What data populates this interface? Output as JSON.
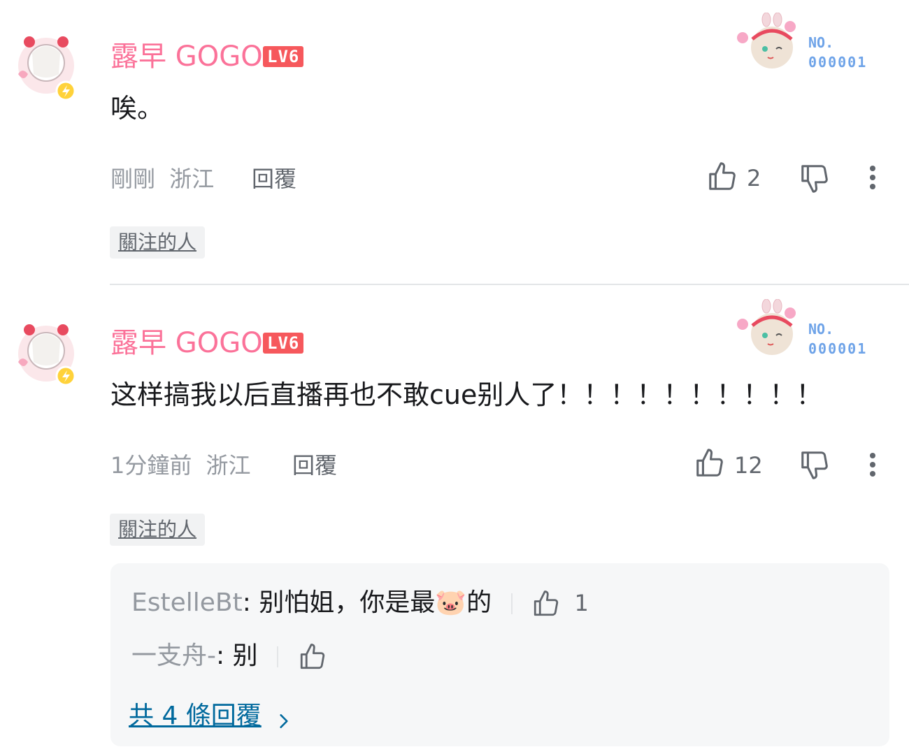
{
  "comments": [
    {
      "username": "露早 GOGO",
      "level": "LV6",
      "badge_no": "NO.",
      "badge_num": "000001",
      "text": "唉。",
      "time": "剛剛",
      "location": "浙江",
      "reply_label": "回覆",
      "likes": "2",
      "tag": "關注的人"
    },
    {
      "username": "露早 GOGO",
      "level": "LV6",
      "badge_no": "NO.",
      "badge_num": "000001",
      "text": "这样搞我以后直播再也不敢cue别人了！！！！！！！！！！",
      "time": "1分鐘前",
      "location": "浙江",
      "reply_label": "回覆",
      "likes": "12",
      "tag": "關注的人",
      "replies": [
        {
          "user": "EstelleBt",
          "colon": ":",
          "text_before": "别怕姐，你是最",
          "emoji": "🐷",
          "text_after": "的",
          "likes": "1"
        },
        {
          "user": "一支舟-",
          "colon": ":",
          "text_before": "别",
          "likes": ""
        }
      ],
      "more_replies": "共 4 條回覆"
    }
  ],
  "colors": {
    "username": "#fb7299",
    "level": "#f6585c",
    "link": "#00699d"
  },
  "icons": [
    "avatar",
    "number-badge",
    "thumb-up-icon",
    "thumb-down-icon",
    "more-icon",
    "chevron-right-icon"
  ]
}
